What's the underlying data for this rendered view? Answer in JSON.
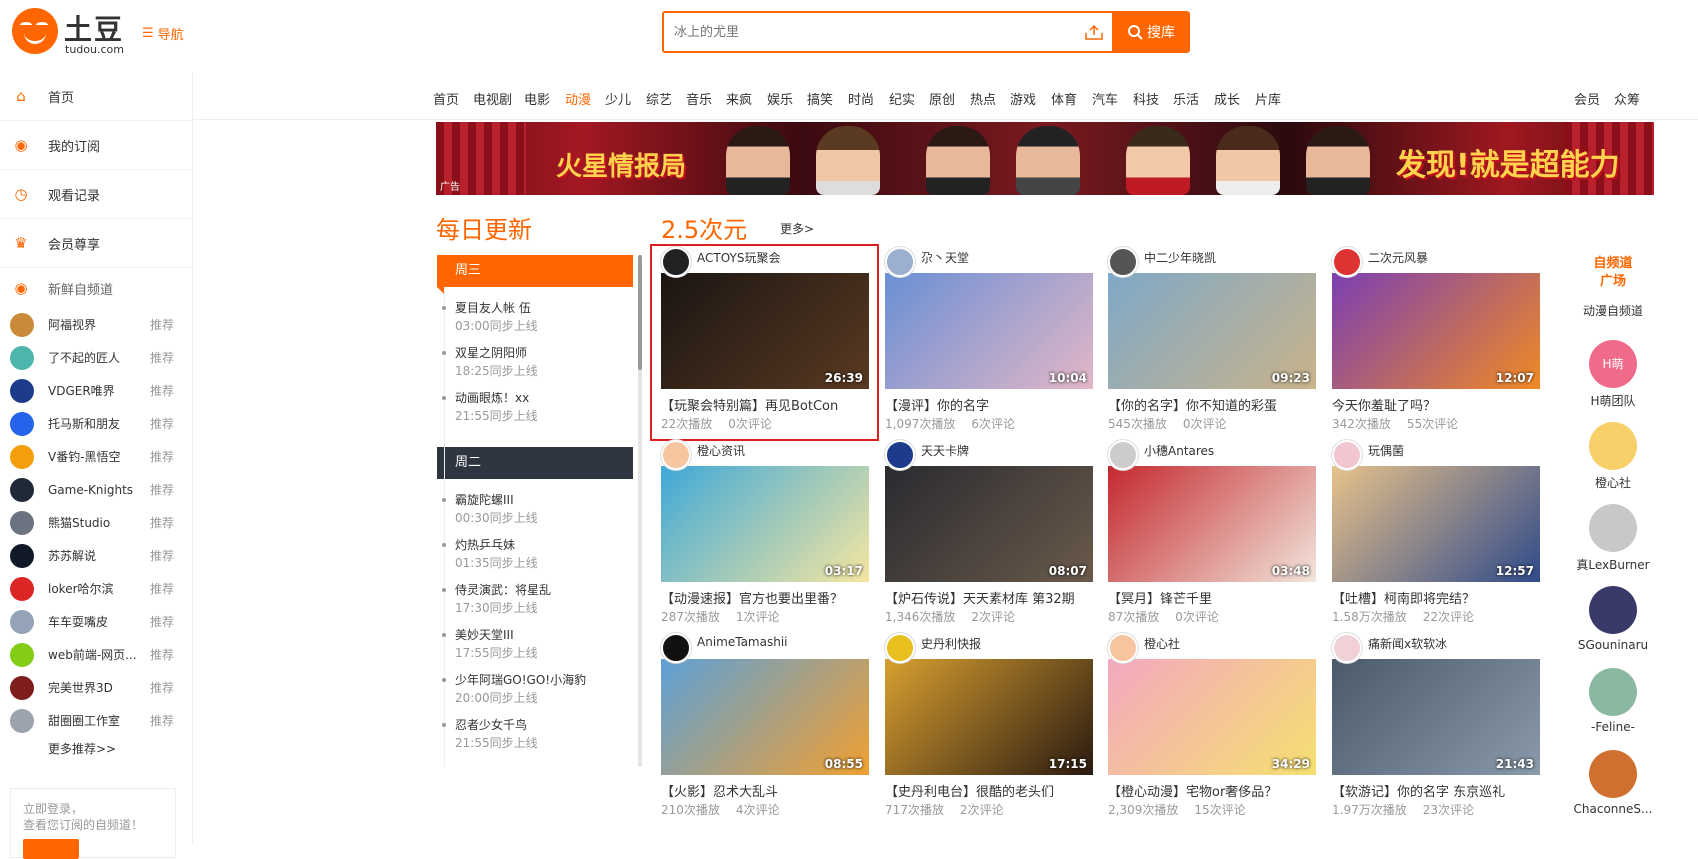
{
  "header": {
    "brand": "土豆",
    "brand_sub": "tudou.com",
    "nav_label": "导航",
    "search_placeholder": "冰上的尤里",
    "search_button": "搜库"
  },
  "sidebar": {
    "main": [
      {
        "label": "首页",
        "icon": "home-icon"
      },
      {
        "label": "我的订阅",
        "icon": "rss-icon"
      },
      {
        "label": "观看记录",
        "icon": "clock-icon"
      },
      {
        "label": "会员尊享",
        "icon": "crown-icon"
      }
    ],
    "section_label": "新鲜自频道",
    "subs": [
      {
        "label": "阿福视界",
        "tag": "推荐",
        "color": "#c98a3a"
      },
      {
        "label": "了不起的匠人",
        "tag": "推荐",
        "color": "#4db6ac"
      },
      {
        "label": "VDGER唯界",
        "tag": "推荐",
        "color": "#1e3a8a"
      },
      {
        "label": "托马斯和朋友",
        "tag": "推荐",
        "color": "#2563eb"
      },
      {
        "label": "V番钓-黑悟空",
        "tag": "推荐",
        "color": "#f59e0b"
      },
      {
        "label": "Game-Knights",
        "tag": "推荐",
        "color": "#1f2937"
      },
      {
        "label": "熊猫Studio",
        "tag": "推荐",
        "color": "#6b7280"
      },
      {
        "label": "苏苏解说",
        "tag": "推荐",
        "color": "#111827"
      },
      {
        "label": "loker哈尔滨",
        "tag": "推荐",
        "color": "#dc2626"
      },
      {
        "label": "车车耍嘴皮",
        "tag": "推荐",
        "color": "#94a3b8"
      },
      {
        "label": "web前端-网页...",
        "tag": "推荐",
        "color": "#84cc16"
      },
      {
        "label": "完美世界3D",
        "tag": "推荐",
        "color": "#7f1d1d"
      },
      {
        "label": "甜圈圈工作室",
        "tag": "推荐",
        "color": "#9ca3af"
      }
    ],
    "more": "更多推荐>>",
    "login_line1": "立即登录，",
    "login_line2": "查看您订阅的自频道！"
  },
  "channels": [
    "首页",
    "电视剧",
    "电影",
    "动漫",
    "少儿",
    "综艺",
    "音乐",
    "来疯",
    "娱乐",
    "搞笑",
    "时尚",
    "纪实",
    "原创",
    "热点",
    "游戏",
    "体育",
    "汽车",
    "科技",
    "乐活",
    "成长",
    "片库"
  ],
  "channels_active": "动漫",
  "channels_right": [
    "会员",
    "众筹"
  ],
  "banner": {
    "ad_label": "广告",
    "left_text": "火星情报局",
    "right_text": "发现!就是超能力"
  },
  "daily": {
    "title": "每日更新",
    "wed": "周三",
    "tue": "周二",
    "wed_items": [
      {
        "name": "夏目友人帐 伍",
        "time": "03:00同步上线"
      },
      {
        "name": "双星之阴阳师",
        "time": "18:25同步上线"
      },
      {
        "name": "动画眼炼！xx",
        "time": "21:55同步上线"
      }
    ],
    "tue_items": [
      {
        "name": "霸旋陀螺III",
        "time": "00:30同步上线"
      },
      {
        "name": "灼热乒乓妹",
        "time": "01:35同步上线"
      },
      {
        "name": "侍灵演武：将星乱",
        "time": "17:30同步上线"
      },
      {
        "name": "美妙天堂III",
        "time": "17:55同步上线"
      },
      {
        "name": "少年阿瑞GO!GO!小海豹",
        "time": "20:00同步上线"
      },
      {
        "name": "忍者少女千鸟",
        "time": "21:55同步上线"
      }
    ]
  },
  "section": {
    "title": "2.5次元",
    "more": "更多>"
  },
  "videos": [
    {
      "user": "ACTOYS玩聚会",
      "duration": "26:39",
      "title": "【玩聚会特别篇】再见BotCon",
      "plays": "22次播放",
      "comments": "0次评论",
      "thumb": "#1a1512",
      "thumb2": "#5a3a22",
      "avatar": "#222"
    },
    {
      "user": "尕丶天堂",
      "duration": "10:04",
      "title": "【漫评】你的名字",
      "plays": "1,097次播放",
      "comments": "6次评论",
      "thumb": "#6a8fd4",
      "thumb2": "#e3b7c7",
      "avatar": "#9bb0d0"
    },
    {
      "user": "中二少年晓凯",
      "duration": "09:23",
      "title": "【你的名字】你不知道的彩蛋",
      "plays": "545次播放",
      "comments": "0次评论",
      "thumb": "#7fa8c8",
      "thumb2": "#c9b38a",
      "avatar": "#555"
    },
    {
      "user": "二次元风暴",
      "duration": "12:07",
      "title": "今天你羞耻了吗？",
      "plays": "342次播放",
      "comments": "55次评论",
      "thumb": "#7b3fb3",
      "thumb2": "#f08a24",
      "avatar": "#d33"
    },
    {
      "user": "橙心资讯",
      "duration": "03:17",
      "title": "【动漫速报】官方也要出里番？",
      "plays": "287次播放",
      "comments": "1次评论",
      "thumb": "#3fa8d8",
      "thumb2": "#f5e6a0",
      "avatar": "#f7c6a0"
    },
    {
      "user": "天天卡牌",
      "duration": "08:07",
      "title": "【炉石传说】天天素材库 第32期",
      "plays": "1,346次播放",
      "comments": "2次评论",
      "thumb": "#2a2a30",
      "thumb2": "#6a5a4a",
      "avatar": "#1e3a8a"
    },
    {
      "user": "小穗Antares",
      "duration": "03:48",
      "title": "【冥月】锋芒千里",
      "plays": "87次播放",
      "comments": "0次评论",
      "thumb": "#c4282e",
      "thumb2": "#f2e6dc",
      "avatar": "#ccc"
    },
    {
      "user": "玩偶菌",
      "duration": "12:57",
      "title": "【吐槽】柯南即将完结？",
      "plays": "1.58万次播放",
      "comments": "22次评论",
      "thumb": "#e8c28a",
      "thumb2": "#2f4a8a",
      "avatar": "#f2c6d0"
    },
    {
      "user": "AnimeTamashii",
      "duration": "08:55",
      "title": "【火影】忍术大乱斗",
      "plays": "210次播放",
      "comments": "4次评论",
      "thumb": "#5ea0d8",
      "thumb2": "#f0a030",
      "avatar": "#111"
    },
    {
      "user": "史丹利快报",
      "duration": "17:15",
      "title": "【史丹利电台】很酷的老头们",
      "plays": "717次播放",
      "comments": "2次评论",
      "thumb": "#d8a030",
      "thumb2": "#2a1a10",
      "avatar": "#e8c020"
    },
    {
      "user": "橙心社",
      "duration": "34:29",
      "title": "【橙心动漫】宅物or奢侈品？",
      "plays": "2,309次播放",
      "comments": "15次评论",
      "thumb": "#f3a8c0",
      "thumb2": "#f6e070",
      "avatar": "#f7c6a0"
    },
    {
      "user": "痛新闻x软软冰",
      "duration": "21:43",
      "title": "【软游记】你的名字 东京巡礼",
      "plays": "1.97万次播放",
      "comments": "23次评论",
      "thumb": "#4a5a6a",
      "thumb2": "#8a9aaa",
      "avatar": "#f2d0d8"
    }
  ],
  "right_col": {
    "title_line1": "自频道",
    "title_line2": "广场",
    "items": [
      {
        "label": "动漫自频道",
        "color": "#fff"
      },
      {
        "label": "H萌团队",
        "color": "#f06a8a",
        "mark": "H萌"
      },
      {
        "label": "橙心社",
        "color": "#f7d06a"
      },
      {
        "label": "真LexBurner",
        "color": "#c8c8c8"
      },
      {
        "label": "SGouninaru",
        "color": "#3a3a6a"
      },
      {
        "label": "-Feline-",
        "color": "#8ab8a0"
      },
      {
        "label": "ChaconneS...",
        "color": "#d07030"
      }
    ]
  }
}
